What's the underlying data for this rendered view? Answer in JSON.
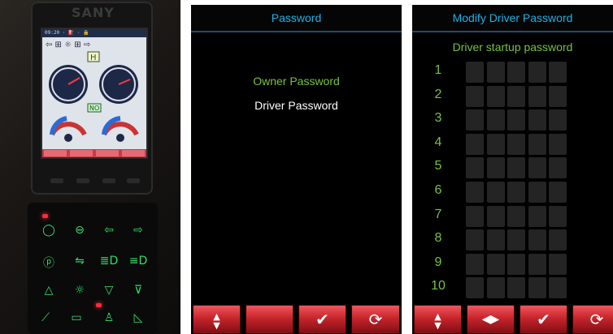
{
  "photo": {
    "brand": "SANY",
    "gear_indicator": "H",
    "mode_indicator": "NO"
  },
  "password_menu": {
    "title": "Password",
    "items": [
      {
        "label": "Owner Password",
        "color": "#76c240"
      },
      {
        "label": "Driver Password",
        "color": "#ffffff"
      }
    ],
    "softkeys": [
      {
        "icon": "up-down-arrows-icon",
        "glyph": "▲▼"
      },
      {
        "icon": "blank",
        "glyph": ""
      },
      {
        "icon": "checkmark-icon",
        "glyph": "✔"
      },
      {
        "icon": "refresh-icon",
        "glyph": "⟳"
      }
    ]
  },
  "modify_password": {
    "title": "Modify Driver Password",
    "subtitle": "Driver startup password",
    "rows": [
      "1",
      "2",
      "3",
      "4",
      "5",
      "6",
      "7",
      "8",
      "9",
      "10"
    ],
    "digits_per_row": 5,
    "softkeys": [
      {
        "icon": "up-down-arrows-icon",
        "glyph": "▲▼"
      },
      {
        "icon": "left-right-arrows-icon",
        "glyph": "◀▶"
      },
      {
        "icon": "checkmark-icon",
        "glyph": "✔"
      },
      {
        "icon": "refresh-icon",
        "glyph": "⟳"
      }
    ]
  },
  "colors": {
    "title_blue": "#1ab3e8",
    "label_green": "#76c240",
    "softkey_red": "#c8252c"
  }
}
